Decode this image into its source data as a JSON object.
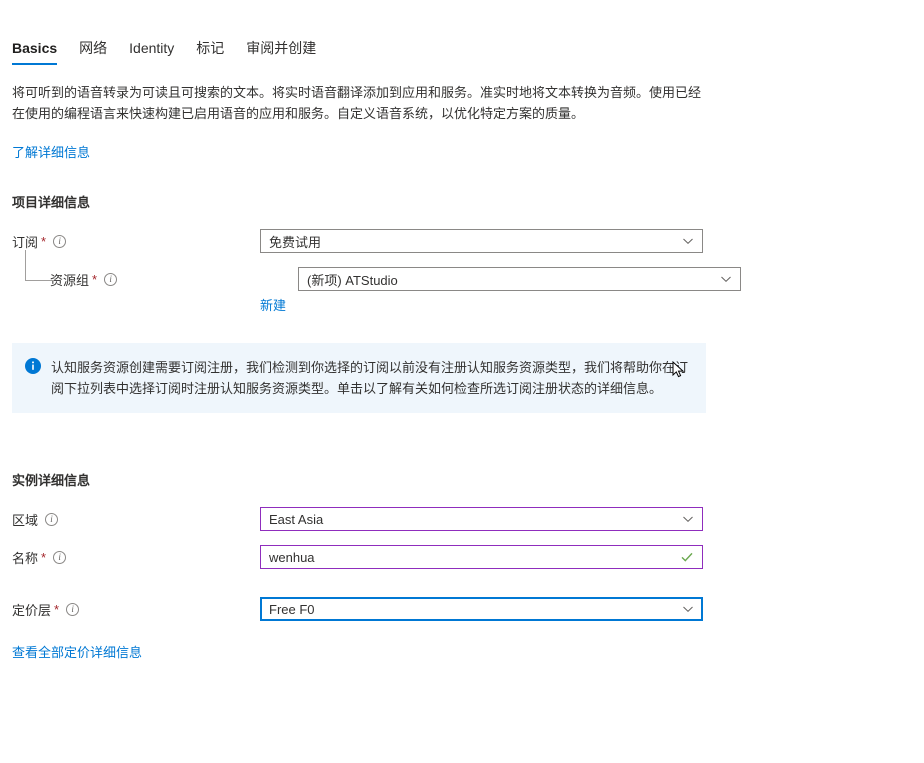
{
  "tabs": [
    {
      "label": "Basics",
      "active": true
    },
    {
      "label": "网络",
      "active": false
    },
    {
      "label": "Identity",
      "active": false
    },
    {
      "label": "标记",
      "active": false
    },
    {
      "label": "审阅并创建",
      "active": false
    }
  ],
  "description": {
    "paragraph": "将可听到的语音转录为可读且可搜索的文本。将实时语音翻译添加到应用和服务。准实时地将文本转换为音频。使用已经在使用的编程语言来快速构建已启用语音的应用和服务。自定义语音系统，以优化特定方案的质量。",
    "learn_more_label": "了解详细信息"
  },
  "project_details": {
    "title": "项目详细信息",
    "subscription": {
      "label": "订阅",
      "required": "*",
      "info": "i",
      "value": "免费试用"
    },
    "resource_group": {
      "label": "资源组",
      "required": "*",
      "info": "i",
      "value": "(新项) ATStudio",
      "create_new_label": "新建"
    }
  },
  "banner": {
    "icon": "info-circle-icon",
    "text": "认知服务资源创建需要订阅注册，我们检测到你选择的订阅以前没有注册认知服务资源类型，我们将帮助你在订阅下拉列表中选择订阅时注册认知服务资源类型。单击以了解有关如何检查所选订阅注册状态的详细信息。",
    "background_color": "#eff6fc"
  },
  "instance_details": {
    "title": "实例详细信息",
    "region": {
      "label": "区域",
      "required": "",
      "info": "i",
      "value": "East Asia"
    },
    "name": {
      "label": "名称",
      "required": "*",
      "info": "i",
      "value": "wenhua"
    },
    "pricing_tier": {
      "label": "定价层",
      "required": "*",
      "info": "i",
      "value": "Free F0"
    },
    "pricing_link_label": "查看全部定价详细信息"
  },
  "colors": {
    "accent": "#0078d4",
    "visited_border": "#8f2dbd",
    "required_red": "#a4262c",
    "success_green": "#6aa84f",
    "banner_bg": "#eff6fc"
  }
}
